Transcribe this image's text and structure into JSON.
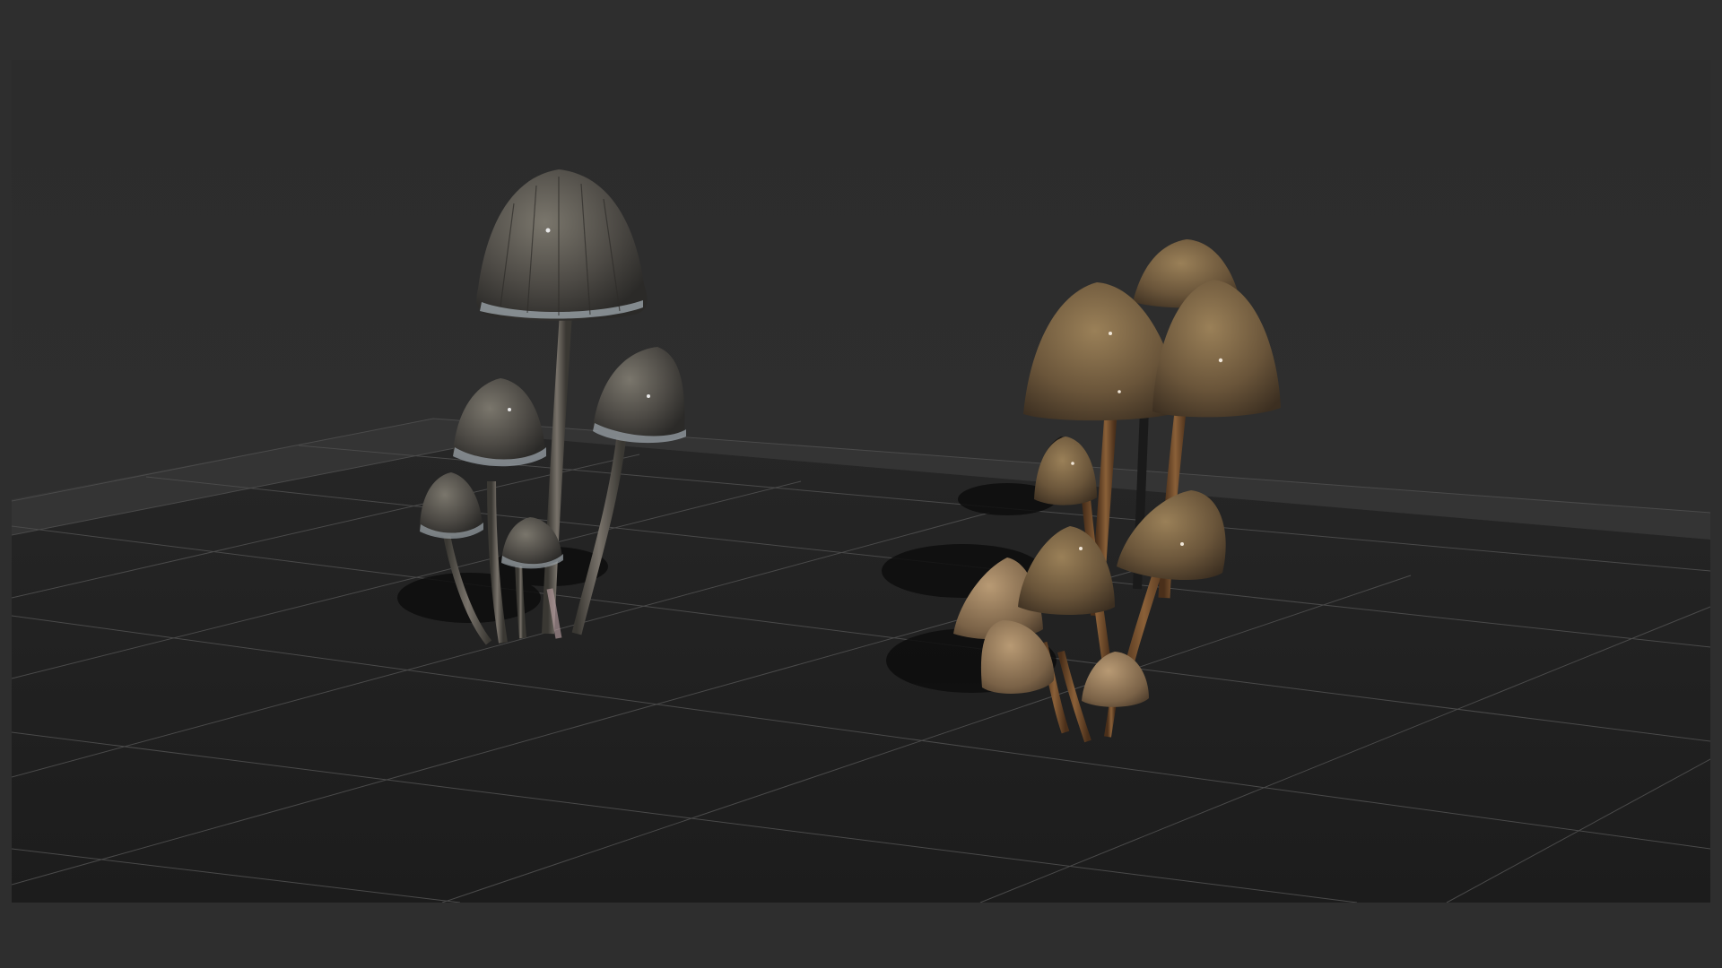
{
  "app": {
    "title": "",
    "theme": {
      "frame_background": "#2e2e2e",
      "viewport_background": "#2c2c2c",
      "floor_color": "#1f1f1f",
      "grid_line_color": "#4a4a4a"
    }
  },
  "viewport": {
    "label": "",
    "scene": {
      "objects": [
        {
          "name": "gray-mushroom-cluster",
          "cap_color": "#5e5b55",
          "stem_color": "#6a655d",
          "count": 6
        },
        {
          "name": "brown-mushroom-cluster",
          "cap_color": "#7a6647",
          "stem_color": "#6b4a2a",
          "count": 9
        }
      ],
      "grid": true
    }
  }
}
